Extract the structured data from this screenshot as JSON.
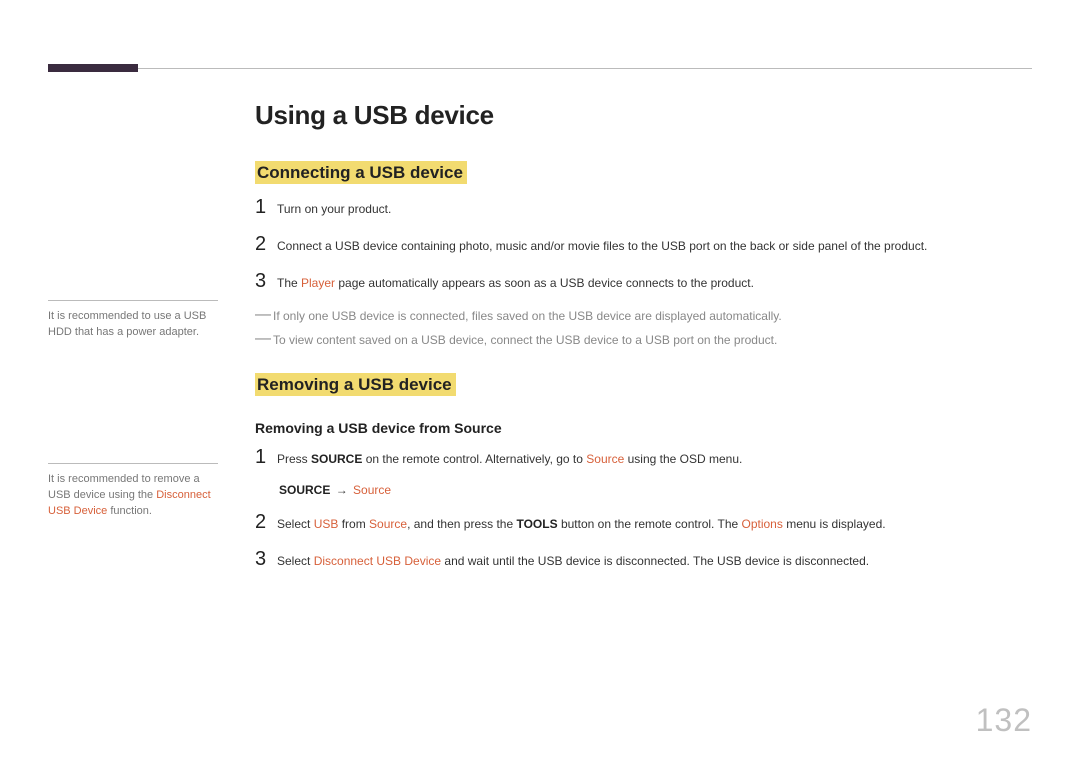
{
  "page": {
    "title": "Using a USB device",
    "number": "132"
  },
  "section_connecting": {
    "heading": "Connecting a USB device",
    "steps": {
      "s1": {
        "num": "1",
        "text": "Turn on your product."
      },
      "s2": {
        "num": "2",
        "text": "Connect a USB device containing photo, music and/or movie files to the USB port on the back or side panel of the product."
      },
      "s3": {
        "num": "3",
        "pre": "The ",
        "hl": "Player",
        "post": " page automatically appears as soon as a USB device connects to the product."
      }
    },
    "notes": {
      "n1": "If only one USB device is connected, files saved on the USB device are displayed automatically.",
      "n2": "To view content saved on a USB device, connect the USB device to a USB port on the product."
    }
  },
  "section_removing": {
    "heading": "Removing a USB device",
    "subheading": "Removing a USB device from Source",
    "steps": {
      "s1": {
        "num": "1",
        "pre": "Press ",
        "bold1": "SOURCE",
        "mid": " on the remote control. Alternatively, go to ",
        "hl": "Source",
        "post": " using the OSD menu."
      },
      "path": {
        "a": "SOURCE",
        "arrow": "→",
        "b": "Source"
      },
      "s2": {
        "num": "2",
        "pre": "Select ",
        "hl1": "USB",
        "mid1": " from ",
        "hl2": "Source",
        "mid2": ", and then press the ",
        "bold1": "TOOLS",
        "mid3": " button on the remote control. The ",
        "hl3": "Options",
        "post": " menu is displayed."
      },
      "s3": {
        "num": "3",
        "pre": "Select ",
        "hl1": "Disconnect USB Device",
        "post": " and wait until the USB device is disconnected. The USB device is disconnected."
      }
    }
  },
  "sidebar": {
    "note1": "It is recommended to use a USB HDD that has a power adapter.",
    "note2_pre": "It is recommended to remove a USB device using the ",
    "note2_hl": "Disconnect USB Device",
    "note2_post": " function."
  }
}
